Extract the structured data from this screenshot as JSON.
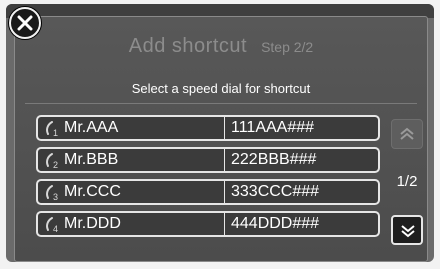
{
  "header": {
    "title": "Add shortcut",
    "step": "Step 2/2"
  },
  "instruction": "Select a speed dial for shortcut",
  "speed_dials": [
    {
      "slot": "1",
      "name": "Mr.AAA",
      "number": "111AAA###"
    },
    {
      "slot": "2",
      "name": "Mr.BBB",
      "number": "222BBB###"
    },
    {
      "slot": "3",
      "name": "Mr.CCC",
      "number": "333CCC###"
    },
    {
      "slot": "4",
      "name": "Mr.DDD",
      "number": "444DDD###"
    }
  ],
  "pagination": {
    "indicator": "1/2"
  },
  "icons": {
    "close": "close-icon",
    "slot": "handset-icon",
    "scroll_up": "double-chevron-up-icon",
    "scroll_down": "double-chevron-down-icon"
  },
  "colors": {
    "panel": "#555555",
    "row_border": "#e6e6e6",
    "title_dim": "#8c8c8c",
    "text": "#ffffff"
  }
}
